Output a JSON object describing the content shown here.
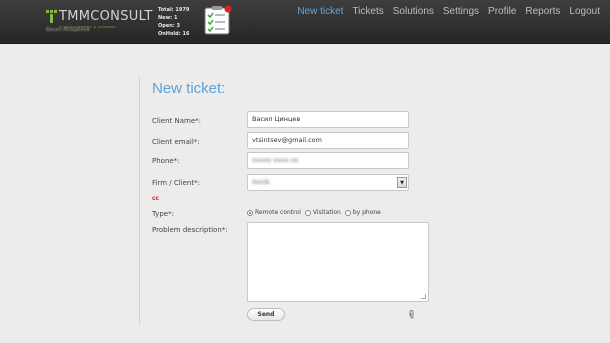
{
  "brand": {
    "name": "TMMCONSULT",
    "tagline": "IT MANAGEMENT & SUPPORT",
    "user": "Васил Младенов"
  },
  "stats": [
    {
      "label": "Total:",
      "value": "1979"
    },
    {
      "label": "New:",
      "value": "1"
    },
    {
      "label": "Open:",
      "value": "3"
    },
    {
      "label": "OnHold:",
      "value": "16"
    }
  ],
  "nav": [
    {
      "label": "New ticket",
      "active": true
    },
    {
      "label": "Tickets"
    },
    {
      "label": "Solutions"
    },
    {
      "label": "Settings"
    },
    {
      "label": "Profile"
    },
    {
      "label": "Reports"
    },
    {
      "label": "Logout"
    }
  ],
  "form": {
    "title": "New ticket:",
    "client_name": {
      "label": "Client Name*:",
      "value": "Васил Цинцев"
    },
    "client_email": {
      "label": "Client email*:",
      "value": "vtsintsev@gmail.com"
    },
    "phone": {
      "label": "Phone*:",
      "value": "xxxxx xxxx xx"
    },
    "firm": {
      "label": "Firm / Client*:",
      "value": "Sonik",
      "arrow": "▼"
    },
    "cc": "cc",
    "type": {
      "label": "Type*:",
      "options": [
        "Remote control",
        "Visitation",
        "by phone"
      ],
      "selected": "Remote control"
    },
    "problem": {
      "label": "Problem description*:",
      "value": ""
    },
    "send": "Send"
  },
  "icons": {
    "clipboard": "clipboard-checklist-icon",
    "attach": "paperclip-icon"
  },
  "colors": {
    "accent": "#5fa8e0",
    "cc": "#dd2222",
    "topbar": "#2e2e2e"
  }
}
